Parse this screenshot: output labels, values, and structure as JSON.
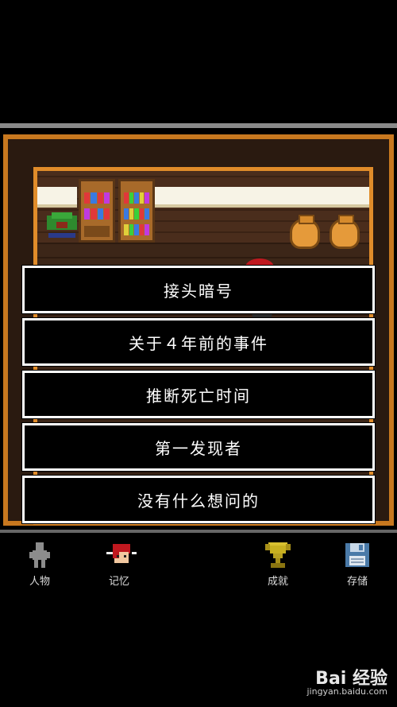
{
  "menu": {
    "options": [
      "接头暗号",
      "关于４年前的事件",
      "推断死亡时间",
      "第一发现者",
      "没有什么想问的"
    ]
  },
  "nav": {
    "characters_label": "人物",
    "memory_label": "记忆",
    "achievements_label": "成就",
    "save_label": "存储"
  },
  "watermark": {
    "logo": "Bai 经验",
    "url": "jingyan.baidu.com"
  },
  "colors": {
    "frame_outer": "#c8781f",
    "frame_inner": "#e08c2a",
    "menu_border": "#ffffff",
    "menu_bg": "#000000"
  }
}
